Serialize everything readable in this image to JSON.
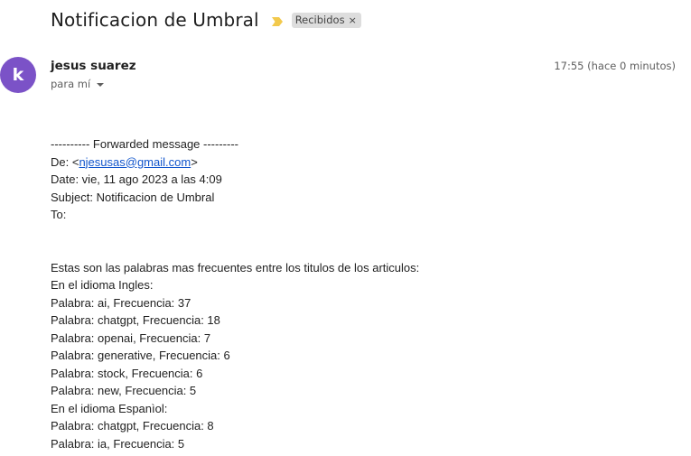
{
  "subject": {
    "title": "Notificacion de Umbral",
    "label_chip": "Recibidos",
    "chip_close": "×",
    "importance_color": "#f2c94c"
  },
  "sender": {
    "avatar_letter": "k",
    "avatar_color": "#7b52c7",
    "name": "jesus suarez",
    "recipient": "para mí",
    "timestamp": "17:55 (hace 0 minutos)"
  },
  "body": {
    "forwarded_header": "---------- Forwarded message ---------",
    "from_prefix": "De: <",
    "from_email": "njesusas@gmail.com",
    "from_suffix": ">",
    "date_line": "Date: vie, 11 ago 2023 a las 4:09",
    "subject_line": "Subject: Notificacion de Umbral",
    "to_line": "To:",
    "lines": [
      "Estas son las palabras mas frecuentes entre los titulos de los articulos:",
      "En el idioma Ingles:",
      "Palabra: ai, Frecuencia: 37",
      "Palabra: chatgpt, Frecuencia: 18",
      "Palabra: openai, Frecuencia: 7",
      "Palabra: generative, Frecuencia: 6",
      "Palabra: stock, Frecuencia: 6",
      "Palabra: new, Frecuencia: 5",
      "En el idioma Espanìol:",
      "Palabra: chatgpt, Frecuencia: 8",
      "Palabra: ia, Frecuencia: 5"
    ]
  }
}
